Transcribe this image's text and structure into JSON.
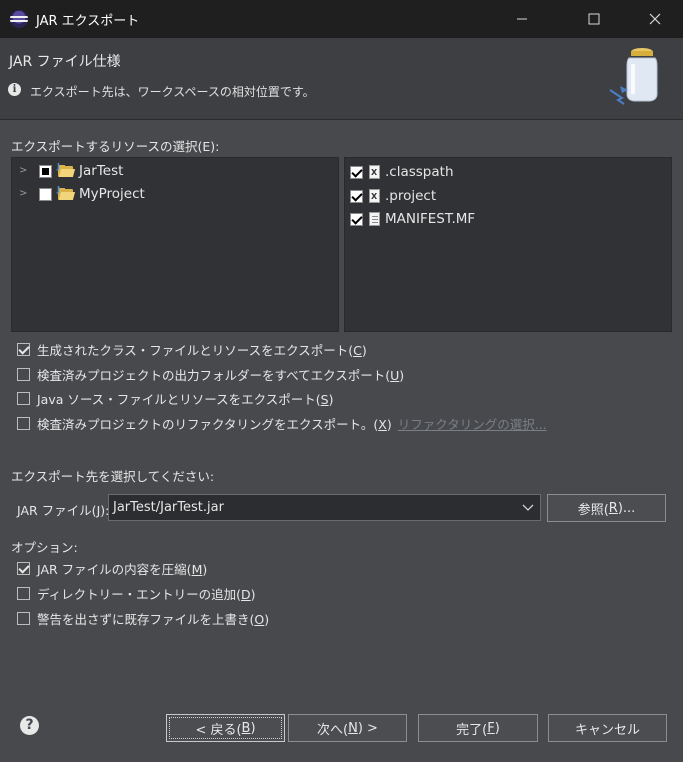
{
  "window": {
    "title": "JAR エクスポート"
  },
  "header": {
    "title": "JAR ファイル仕様",
    "message": "エクスポート先は、ワークスペースの相対位置です。"
  },
  "resources": {
    "label": "エクスポートするリソースの選択(E):",
    "tree": [
      {
        "label": "JarTest",
        "state": "partial"
      },
      {
        "label": "MyProject",
        "state": "unchecked"
      }
    ],
    "files": [
      {
        "label": ".classpath",
        "icon": "xml-file-icon",
        "checked": true
      },
      {
        "label": ".project",
        "icon": "xml-file-icon",
        "checked": true
      },
      {
        "label": "MANIFEST.MF",
        "icon": "text-file-icon",
        "checked": true
      }
    ]
  },
  "export_options": [
    {
      "pre": "生成されたクラス・ファイルとリソースをエクスポート(",
      "key": "C",
      "post": ")",
      "checked": true
    },
    {
      "pre": "検査済みプロジェクトの出力フォルダーをすべてエクスポート(",
      "key": "U",
      "post": ")",
      "checked": false
    },
    {
      "pre": "Java ソース・ファイルとリソースをエクスポート(",
      "key": "S",
      "post": ")",
      "checked": false
    },
    {
      "pre": "検査済みプロジェクトのリファクタリングをエクスポート。(",
      "key": "X",
      "post": ")",
      "checked": false
    }
  ],
  "refactoring_link": "リファクタリングの選択...",
  "destination": {
    "label": "エクスポート先を選択してください:",
    "jar_label_pre": "JAR ファイル(",
    "jar_label_key": "J",
    "jar_label_post": "):",
    "jar_value": "JarTest/JarTest.jar",
    "browse_pre": "参照(",
    "browse_key": "R",
    "browse_post": ")..."
  },
  "options": {
    "label": "オプション:",
    "items": [
      {
        "pre": "JAR ファイルの内容を圧縮(",
        "key": "M",
        "post": ")",
        "checked": true
      },
      {
        "pre": "ディレクトリー・エントリーの追加(",
        "key": "D",
        "post": ")",
        "checked": false
      },
      {
        "pre": "警告を出さずに既存ファイルを上書き(",
        "key": "O",
        "post": ")",
        "checked": false
      }
    ]
  },
  "buttons": {
    "back_pre": "< 戻る(",
    "back_key": "B",
    "back_post": ")",
    "next_pre": "次へ(",
    "next_key": "N",
    "next_post": ") >",
    "finish_pre": "完了(",
    "finish_key": "F",
    "finish_post": ")",
    "cancel": "キャンセル"
  }
}
